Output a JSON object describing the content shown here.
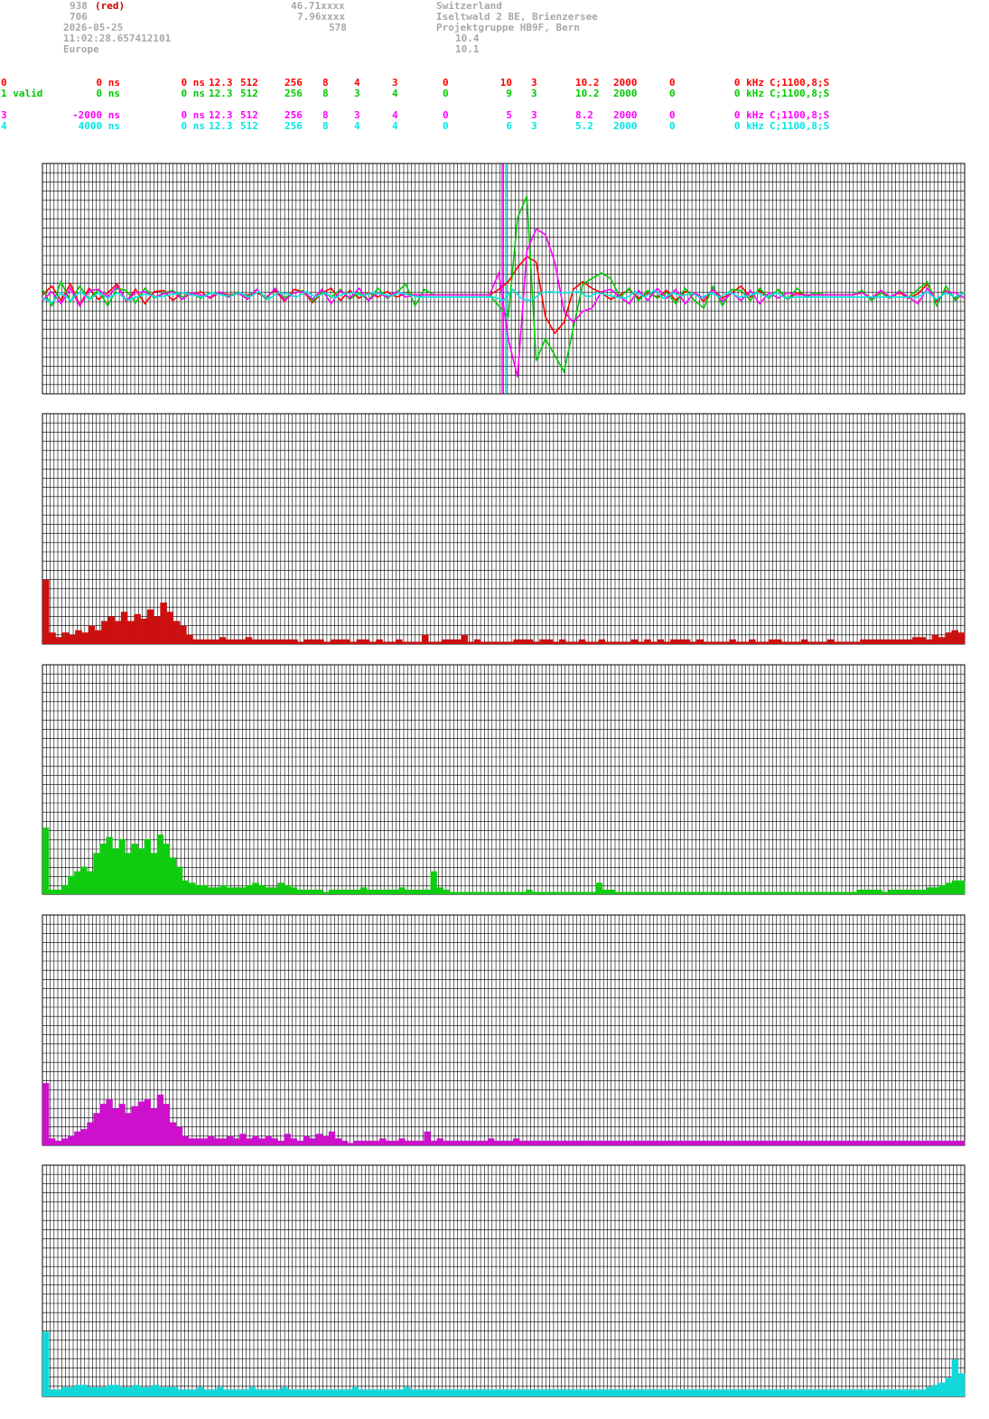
{
  "header": {
    "col1": [
      "938",
      "706",
      "2026-05-25",
      "11:02:28.657412101",
      "Europe"
    ],
    "col1_tag": "(red)",
    "col2": [
      "46.71xxxx",
      "7.96xxxx",
      "578"
    ],
    "col3": [
      "Switzerland",
      "Iseltwald 2 BE, Brienzersee",
      "Projektgruppe HB9F, Bern",
      "10.4",
      "10.1"
    ]
  },
  "stations": [
    {
      "c": [
        "0",
        "0 ns",
        "0 ns",
        "12.3",
        "512",
        "256",
        "8",
        "4",
        "3",
        "0",
        "10",
        "3",
        "10.2",
        "2000",
        "0",
        "0 kHz",
        "C;1100,8;S"
      ],
      "color": "#ff0000"
    },
    {
      "c": [
        "1 valid",
        "0 ns",
        "0 ns",
        "12.3",
        "512",
        "256",
        "8",
        "3",
        "4",
        "0",
        "9",
        "3",
        "10.2",
        "2000",
        "0",
        "0 kHz",
        "C;1100,8;S"
      ],
      "color": "#00c800"
    },
    {
      "c": [
        "3",
        "-2000 ns",
        "0 ns",
        "12.3",
        "512",
        "256",
        "8",
        "3",
        "4",
        "0",
        "5",
        "3",
        "8.2",
        "2000",
        "0",
        "0 kHz",
        "C;1100,8;S"
      ],
      "color": "#ff00ff"
    },
    {
      "c": [
        "4",
        "4000 ns",
        "0 ns",
        "12.3",
        "512",
        "256",
        "8",
        "4",
        "4",
        "0",
        "6",
        "3",
        "5.2",
        "2000",
        "0",
        "0 kHz",
        "C;1100,8;S"
      ],
      "color": "#00e6e6"
    }
  ],
  "colors": {
    "red": "#cc1010",
    "green": "#10cc10",
    "magenta": "#cc10cc",
    "cyan": "#10d8d8",
    "grid": "#000000"
  },
  "chart_data": [
    {
      "type": "line",
      "series": [
        {
          "color": "#ff0000",
          "values": [
            0,
            0.08,
            -0.05,
            0.1,
            -0.09,
            0.06,
            -0.04,
            0.02,
            0.1,
            -0.06,
            0.05,
            -0.08,
            0.03,
            0.04,
            -0.05,
            0.02,
            0,
            0.03,
            -0.03,
            0.02,
            0,
            0.01,
            0,
            0.02,
            -0.02,
            0.04,
            -0.06,
            0.05,
            0.03,
            -0.07,
            0.02,
            0.06,
            -0.05,
            0.04,
            -0.03,
            0.02,
            -0.02,
            0.03,
            -0.02,
            0.01,
            0,
            0,
            0,
            0,
            0,
            0,
            0,
            0,
            0,
            0.05,
            0.12,
            0.25,
            0.35,
            0.3,
            -0.2,
            -0.35,
            -0.25,
            0.05,
            0.12,
            0.06,
            0.02,
            -0.04,
            0,
            0.05,
            -0.03,
            0.02,
            -0.02,
            0.04,
            -0.05,
            0.03,
            0.02,
            -0.06,
            0.05,
            -0.03,
            0.02,
            0.08,
            -0.02,
            0.04,
            -0.03,
            0.05,
            -0.04,
            0.02,
            0,
            0,
            0,
            0,
            0,
            0,
            0.02,
            -0.03,
            0.04,
            -0.02,
            0.02,
            -0.03,
            0.01,
            0.1,
            -0.06,
            0.04,
            -0.03,
            0.02
          ]
        },
        {
          "color": "#00c800",
          "values": [
            0.05,
            -0.1,
            0.12,
            -0.06,
            0.08,
            -0.04,
            0.05,
            -0.1,
            0.06,
            0.04,
            -0.07,
            0.06,
            -0.03,
            0.02,
            0.04,
            -0.02,
            0.01,
            -0.03,
            0.02,
            0.01,
            -0.02,
            0.03,
            -0.02,
            0.05,
            -0.04,
            0.06,
            -0.03,
            0.02,
            0.04,
            -0.06,
            0.03,
            -0.02,
            0.05,
            -0.04,
            0.02,
            -0.05,
            0.06,
            -0.03,
            0.02,
            0.1,
            -0.1,
            0.05,
            0,
            0,
            0,
            0,
            0,
            0,
            0,
            -0.1,
            -0.2,
            0.7,
            0.9,
            -0.6,
            -0.4,
            -0.55,
            -0.7,
            -0.3,
            0.1,
            0.15,
            0.2,
            0.15,
            -0.02,
            0.06,
            -0.05,
            0.04,
            -0.03,
            0.02,
            -0.08,
            0.06,
            -0.05,
            -0.12,
            0.08,
            -0.1,
            0.05,
            0.04,
            -0.05,
            0.06,
            -0.03,
            0.05,
            -0.04,
            0.06,
            -0.02,
            0.02,
            0,
            0,
            0,
            0,
            0.04,
            -0.05,
            0.02,
            -0.03,
            0.04,
            -0.02,
            0.05,
            0.12,
            -0.1,
            0.08,
            -0.05,
            0.03
          ]
        },
        {
          "color": "#ff00ff",
          "values": [
            -0.05,
            0.03,
            -0.08,
            0.06,
            -0.1,
            0.04,
            0.05,
            -0.02,
            0.08,
            -0.05,
            0.02,
            0.03,
            -0.02,
            0.01,
            0.03,
            -0.04,
            0.02,
            0,
            -0.02,
            0.03,
            -0.02,
            0.02,
            -0.04,
            0.05,
            -0.03,
            0.06,
            -0.05,
            0.02,
            0.03,
            -0.04,
            0.05,
            -0.08,
            0.04,
            -0.03,
            0.06,
            -0.05,
            0.02,
            -0.02,
            0.03,
            -0.02,
            0,
            0,
            0,
            0,
            0,
            0,
            0,
            0,
            0,
            0.2,
            -0.4,
            -0.75,
            0.4,
            0.6,
            0.55,
            0.3,
            -0.15,
            -0.25,
            -0.15,
            -0.12,
            0.03,
            0.05,
            -0.02,
            -0.08,
            0.04,
            -0.05,
            0.06,
            -0.03,
            0.05,
            -0.08,
            0.02,
            -0.03,
            0.05,
            -0.06,
            0.02,
            -0.05,
            0.04,
            -0.08,
            0.02,
            -0.03,
            0.02,
            0,
            0,
            0,
            0,
            0,
            0,
            0,
            0.02,
            -0.03,
            0.04,
            -0.02,
            0.03,
            -0.02,
            -0.08,
            0.06,
            -0.05,
            0.03,
            0.02,
            -0.03
          ]
        },
        {
          "color": "#00e6e6",
          "values": [
            -0.03,
            -0.07,
            0.02,
            -0.05,
            0.03,
            -0.04,
            0.02,
            -0.03,
            0.02,
            -0.05,
            -0.02,
            0.01,
            -0.02,
            -0.01,
            0.01,
            0.02,
            0,
            -0.02,
            0.02,
            0,
            -0.01,
            0.02,
            -0.02,
            0.03,
            -0.04,
            0.02,
            0.01,
            -0.02,
            0.03,
            -0.02,
            0.02,
            -0.03,
            0.01,
            0.02,
            -0.01,
            0.02,
            0.01,
            -0.01,
            0.02,
            0,
            -0.02,
            -0.02,
            -0.02,
            -0.02,
            -0.02,
            -0.02,
            -0.02,
            -0.02,
            -0.02,
            -0.05,
            0.05,
            -0.04,
            -0.05,
            0.02,
            0.03,
            0.02,
            0.02,
            0.03,
            -0.02,
            0.02,
            0,
            -0.02,
            -0.03,
            0.03,
            -0.02,
            0.04,
            -0.03,
            0.02,
            -0.01,
            0.02,
            -0.03,
            0.02,
            -0.02,
            0.03,
            -0.02,
            -0.01,
            0.02,
            -0.02,
            0.02,
            -0.03,
            -0.02,
            -0.02,
            -0.02,
            -0.02,
            -0.02,
            -0.02,
            -0.02,
            -0.02,
            -0.02,
            -0.02,
            -0.02,
            -0.02,
            -0.02,
            -0.02,
            0.03,
            -0.04,
            0.02,
            -0.02,
            0.02
          ]
        }
      ],
      "ylim": [
        -1,
        1
      ],
      "grid": true
    },
    {
      "type": "bar",
      "color": "#cc1010",
      "values": [
        0.28,
        0.05,
        0.03,
        0.05,
        0.04,
        0.06,
        0.05,
        0.08,
        0.06,
        0.1,
        0.12,
        0.1,
        0.14,
        0.1,
        0.13,
        0.11,
        0.15,
        0.12,
        0.18,
        0.14,
        0.1,
        0.08,
        0.04,
        0.02,
        0.02,
        0.02,
        0.02,
        0.03,
        0.02,
        0.02,
        0.02,
        0.03,
        0.02,
        0.02,
        0.02,
        0.02,
        0.02,
        0.02,
        0.02,
        0.01,
        0.02,
        0.02,
        0.02,
        0.01,
        0.02,
        0.02,
        0.02,
        0.01,
        0.02,
        0.02,
        0.01,
        0.02,
        0.01,
        0.01,
        0.02,
        0.01,
        0.01,
        0.01,
        0.04,
        0.01,
        0.01,
        0.02,
        0.02,
        0.02,
        0.04,
        0.01,
        0.02,
        0.01,
        0.01,
        0.01,
        0.01,
        0.01,
        0.02,
        0.02,
        0.02,
        0.01,
        0.02,
        0.02,
        0.01,
        0.02,
        0.01,
        0.01,
        0.02,
        0.01,
        0.01,
        0.02,
        0.01,
        0.01,
        0.01,
        0.01,
        0.02,
        0.01,
        0.02,
        0.01,
        0.02,
        0.01,
        0.02,
        0.02,
        0.02,
        0.01,
        0.02,
        0.01,
        0.01,
        0.01,
        0.01,
        0.02,
        0.01,
        0.01,
        0.02,
        0.01,
        0.01,
        0.02,
        0.02,
        0.01,
        0.01,
        0.01,
        0.02,
        0.01,
        0.01,
        0.01,
        0.02,
        0.01,
        0.01,
        0.01,
        0.01,
        0.02,
        0.02,
        0.02,
        0.02,
        0.02,
        0.02,
        0.02,
        0.02,
        0.03,
        0.03,
        0.02,
        0.04,
        0.03,
        0.05,
        0.06,
        0.05
      ]
    },
    {
      "type": "bar",
      "color": "#10cc10",
      "values": [
        0.29,
        0.02,
        0.02,
        0.04,
        0.08,
        0.1,
        0.12,
        0.1,
        0.18,
        0.22,
        0.25,
        0.2,
        0.24,
        0.18,
        0.22,
        0.2,
        0.24,
        0.18,
        0.26,
        0.22,
        0.16,
        0.12,
        0.06,
        0.05,
        0.04,
        0.04,
        0.03,
        0.03,
        0.04,
        0.03,
        0.03,
        0.03,
        0.04,
        0.05,
        0.04,
        0.03,
        0.03,
        0.05,
        0.04,
        0.03,
        0.02,
        0.02,
        0.02,
        0.02,
        0.01,
        0.02,
        0.02,
        0.02,
        0.02,
        0.02,
        0.03,
        0.02,
        0.02,
        0.02,
        0.02,
        0.02,
        0.03,
        0.02,
        0.02,
        0.02,
        0.02,
        0.1,
        0.03,
        0.02,
        0.01,
        0.01,
        0.01,
        0.01,
        0.01,
        0.01,
        0.01,
        0.01,
        0.01,
        0.01,
        0.01,
        0.01,
        0.02,
        0.01,
        0.01,
        0.01,
        0.01,
        0.01,
        0.01,
        0.01,
        0.01,
        0.01,
        0.01,
        0.05,
        0.02,
        0.02,
        0.01,
        0.01,
        0.01,
        0.01,
        0.01,
        0.01,
        0.01,
        0.01,
        0.01,
        0.01,
        0.01,
        0.01,
        0.01,
        0.01,
        0.01,
        0.01,
        0.01,
        0.01,
        0.01,
        0.01,
        0.01,
        0.01,
        0.01,
        0.01,
        0.01,
        0.01,
        0.01,
        0.01,
        0.01,
        0.01,
        0.01,
        0.01,
        0.01,
        0.01,
        0.01,
        0.01,
        0.01,
        0.01,
        0.02,
        0.02,
        0.02,
        0.02,
        0.01,
        0.02,
        0.02,
        0.02,
        0.02,
        0.02,
        0.02,
        0.03,
        0.03,
        0.04,
        0.05,
        0.06,
        0.06
      ]
    },
    {
      "type": "bar",
      "color": "#cc10cc",
      "values": [
        0.27,
        0.03,
        0.02,
        0.03,
        0.04,
        0.06,
        0.07,
        0.1,
        0.14,
        0.18,
        0.2,
        0.16,
        0.18,
        0.14,
        0.17,
        0.19,
        0.2,
        0.16,
        0.22,
        0.18,
        0.1,
        0.08,
        0.04,
        0.03,
        0.03,
        0.03,
        0.04,
        0.03,
        0.03,
        0.04,
        0.03,
        0.05,
        0.03,
        0.04,
        0.03,
        0.04,
        0.03,
        0.02,
        0.05,
        0.03,
        0.02,
        0.04,
        0.03,
        0.05,
        0.04,
        0.06,
        0.03,
        0.02,
        0.01,
        0.02,
        0.02,
        0.02,
        0.02,
        0.03,
        0.02,
        0.02,
        0.03,
        0.02,
        0.02,
        0.02,
        0.06,
        0.02,
        0.03,
        0.02,
        0.02,
        0.02,
        0.02,
        0.02,
        0.02,
        0.02,
        0.03,
        0.02,
        0.02,
        0.02,
        0.03,
        0.02,
        0.02,
        0.02,
        0.02,
        0.02,
        0.02,
        0.02,
        0.02,
        0.02,
        0.02,
        0.02,
        0.02,
        0.02,
        0.02,
        0.02,
        0.02,
        0.02,
        0.02,
        0.02,
        0.02,
        0.02,
        0.02,
        0.02,
        0.02,
        0.02,
        0.02,
        0.02,
        0.02,
        0.02,
        0.02,
        0.02,
        0.02,
        0.02,
        0.02,
        0.02,
        0.02,
        0.02,
        0.02,
        0.02,
        0.02,
        0.02,
        0.02,
        0.02,
        0.02,
        0.02,
        0.02,
        0.02,
        0.02,
        0.02,
        0.02,
        0.02,
        0.02,
        0.02,
        0.02,
        0.02,
        0.02,
        0.02,
        0.02,
        0.02,
        0.02,
        0.02,
        0.02,
        0.02,
        0.02,
        0.02,
        0.02,
        0.02,
        0.02,
        0.02,
        0.02
      ]
    },
    {
      "type": "bar",
      "color": "#10d8d8",
      "values": [
        0.28,
        0.03,
        0.03,
        0.04,
        0.04,
        0.05,
        0.05,
        0.04,
        0.04,
        0.04,
        0.05,
        0.05,
        0.04,
        0.04,
        0.05,
        0.04,
        0.04,
        0.05,
        0.04,
        0.04,
        0.04,
        0.03,
        0.03,
        0.03,
        0.04,
        0.03,
        0.03,
        0.04,
        0.03,
        0.03,
        0.03,
        0.03,
        0.04,
        0.03,
        0.03,
        0.03,
        0.03,
        0.04,
        0.03,
        0.03,
        0.03,
        0.03,
        0.03,
        0.03,
        0.03,
        0.03,
        0.03,
        0.03,
        0.04,
        0.03,
        0.03,
        0.03,
        0.03,
        0.03,
        0.03,
        0.03,
        0.04,
        0.03,
        0.03,
        0.03,
        0.03,
        0.03,
        0.03,
        0.03,
        0.03,
        0.03,
        0.03,
        0.03,
        0.03,
        0.03,
        0.03,
        0.03,
        0.03,
        0.03,
        0.03,
        0.03,
        0.03,
        0.03,
        0.03,
        0.03,
        0.03,
        0.03,
        0.03,
        0.03,
        0.03,
        0.03,
        0.03,
        0.03,
        0.03,
        0.03,
        0.03,
        0.03,
        0.03,
        0.03,
        0.03,
        0.03,
        0.03,
        0.03,
        0.03,
        0.03,
        0.03,
        0.03,
        0.03,
        0.03,
        0.03,
        0.03,
        0.03,
        0.03,
        0.03,
        0.03,
        0.03,
        0.03,
        0.03,
        0.03,
        0.03,
        0.03,
        0.03,
        0.03,
        0.03,
        0.03,
        0.03,
        0.03,
        0.03,
        0.03,
        0.03,
        0.03,
        0.03,
        0.03,
        0.03,
        0.03,
        0.03,
        0.03,
        0.03,
        0.03,
        0.03,
        0.03,
        0.03,
        0.04,
        0.05,
        0.06,
        0.08,
        0.16,
        0.1
      ]
    }
  ]
}
